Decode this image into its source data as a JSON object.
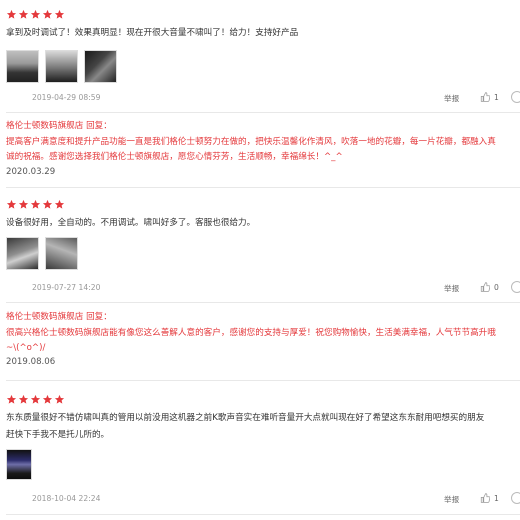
{
  "colors": {
    "star": "#e4393c",
    "reply": "#e4393c",
    "meta": "#999999",
    "divider": "#e8e8e8"
  },
  "reviews": [
    {
      "rating": 5,
      "text_lines": [
        "拿到及时调试了！效果真明显！现在开很大音量不啸叫了！给力！支持好产品"
      ],
      "date": "2019-04-29 08:59",
      "report_label": "举报",
      "likes": "1",
      "image_count": 3,
      "reply": {
        "header": "格伦士顿数码旗舰店 回复：",
        "lines": [
          "提高客户满意度和提升产品功能一直是我们格伦士顿努力在做的，把快乐温馨化作清风，吹落一地的花瓣，每一片花瓣，都融入真",
          "诚的祝福。感谢您选择我们格伦士顿旗舰店，愿您心情芬芳，生活顺畅，幸福绵长！^_^"
        ],
        "date": "2020.03.29"
      }
    },
    {
      "rating": 5,
      "text_lines": [
        "设备很好用，全自动的。不用调试。啸叫好多了。客服也很给力。"
      ],
      "date": "2019-07-27 14:20",
      "report_label": "举报",
      "likes": "0",
      "image_count": 2,
      "reply": {
        "header": "格伦士顿数码旗舰店 回复：",
        "lines": [
          "很高兴格伦士顿数码旗舰店能有像您这么善解人意的客户，感谢您的支持与厚爱！祝您购物愉快，生活美满幸福，人气节节高升哦",
          "~\\(^o^)/"
        ],
        "date": "2019.08.06"
      }
    },
    {
      "rating": 5,
      "text_lines": [
        "东东质量很好不错仿啸叫真的管用以前没用这机器之前K歌声音实在难听音量开大点就叫现在好了希望这东东耐用吧想买的朋友",
        "赶快下手我不是托儿所的。"
      ],
      "date": "2018-10-04 22:24",
      "report_label": "举报",
      "likes": "1",
      "image_count": 1
    }
  ]
}
